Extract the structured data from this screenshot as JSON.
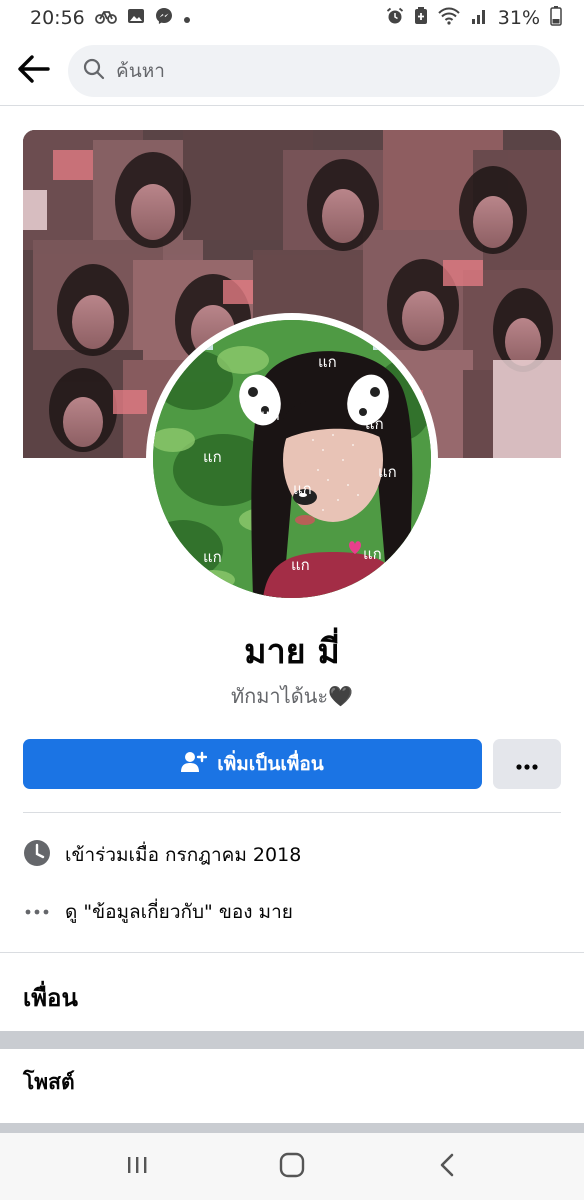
{
  "status_bar": {
    "time": "20:56",
    "battery": "31%",
    "left_icons": [
      "bike-icon",
      "image-icon",
      "messenger-icon",
      "dot-icon"
    ],
    "right_icons": [
      "alarm-icon",
      "battery-saver-icon",
      "wifi-icon",
      "signal-icon",
      "battery-icon"
    ]
  },
  "search": {
    "placeholder": "ค้นหา"
  },
  "profile": {
    "name": "มาย มี่",
    "bio": "ทักมาได้นะ🖤"
  },
  "actions": {
    "add_friend_label": "เพิ่มเป็นเพื่อน",
    "more_label": "···"
  },
  "info": {
    "joined": "เข้าร่วมเมื่อ กรกฎาคม  2018",
    "about": "ดู \"ข้อมูลเกี่ยวกับ\" ของ มาย",
    "about_dots": "···"
  },
  "sections": {
    "friends": "เพื่อน",
    "posts": "โพสต์"
  },
  "avatar_overlay_text": [
    "แก",
    "แก",
    "แก",
    "แก",
    "แก",
    "แก",
    "แก",
    "แก",
    "แก"
  ],
  "colors": {
    "accent": "#1b74e4",
    "secondary_button": "#e4e6eb",
    "muted_text": "#65676b",
    "divider": "#dadde1"
  }
}
